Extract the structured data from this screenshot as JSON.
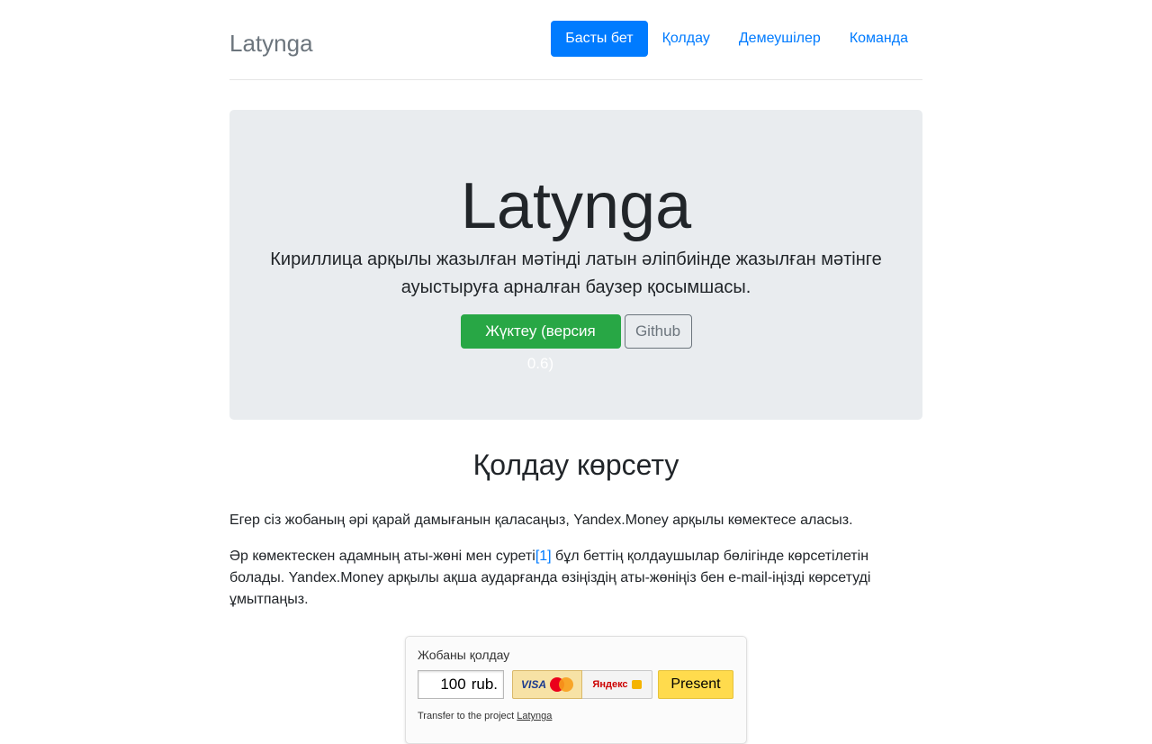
{
  "header": {
    "brand": "Latynga",
    "nav": [
      {
        "label": "Басты бет",
        "active": true
      },
      {
        "label": "Қолдау",
        "active": false
      },
      {
        "label": "Демеушілер",
        "active": false
      },
      {
        "label": "Команда",
        "active": false
      }
    ]
  },
  "jumbotron": {
    "title": "Latynga",
    "lead_line1": "Кириллица арқылы жазылған мәтінді латын әліпбиінде жазылған мәтінге",
    "lead_line2": "ауыстыруға арналған баузер қосымшасы.",
    "download_button": "Жүктеу (версия 0.6)",
    "github_button": "Github"
  },
  "support": {
    "title": "Қолдау көрсету",
    "paragraph1": "Егер сіз жобаның әрі қарай дамығанын қаласаңыз, Yandex.Money арқылы көмектесе аласыз.",
    "paragraph2_part1": "Әр көмектескен адамның аты-жөні мен суреті",
    "paragraph2_ref": "[1]",
    "paragraph2_part2": " бұл беттің қолдаушылар бөлігінде көрсетілетін болады. Yandex.Money арқылы ақша аударғанда өзіңіздің аты-жөніңіз бен e-mail-іңізді көрсетуді ұмытпаңыз."
  },
  "widget": {
    "title": "Жобаны қолдау",
    "amount": "100",
    "currency": "rub.",
    "card_label": "VISA",
    "yandex_label": "Яндекс",
    "present_button": "Present",
    "footer_text": "Transfer to the project ",
    "footer_link": "Latynga"
  },
  "colors": {
    "primary": "#007bff",
    "success": "#28a745",
    "jumbotron_bg": "#e9ecef",
    "present_yellow": "#ffdb4d"
  }
}
